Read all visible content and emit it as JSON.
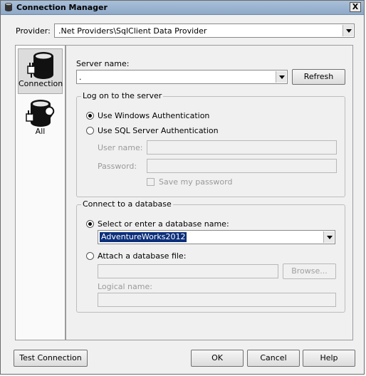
{
  "window": {
    "title": "Connection Manager",
    "close_label": "X"
  },
  "provider": {
    "label": "Provider:",
    "value": ".Net Providers\\SqlClient Data Provider"
  },
  "nav": {
    "items": [
      {
        "label": "Connection",
        "icon": "database-plug-icon"
      },
      {
        "label": "All",
        "icon": "database-wrench-icon"
      }
    ]
  },
  "server": {
    "label": "Server name:",
    "value": ".",
    "refresh_label": "Refresh"
  },
  "logon": {
    "group_title": "Log on to the server",
    "windows_auth": "Use Windows Authentication",
    "sql_auth": "Use SQL Server Authentication",
    "username_label": "User name:",
    "password_label": "Password:",
    "save_password": "Save my password",
    "selected": "windows"
  },
  "database": {
    "group_title": "Connect to a database",
    "select_label": "Select or enter a database name:",
    "selected_db": "AdventureWorks2012",
    "attach_label": "Attach a database file:",
    "browse_label": "Browse...",
    "logical_label": "Logical name:"
  },
  "footer": {
    "test_label": "Test Connection",
    "ok_label": "OK",
    "cancel_label": "Cancel",
    "help_label": "Help"
  }
}
